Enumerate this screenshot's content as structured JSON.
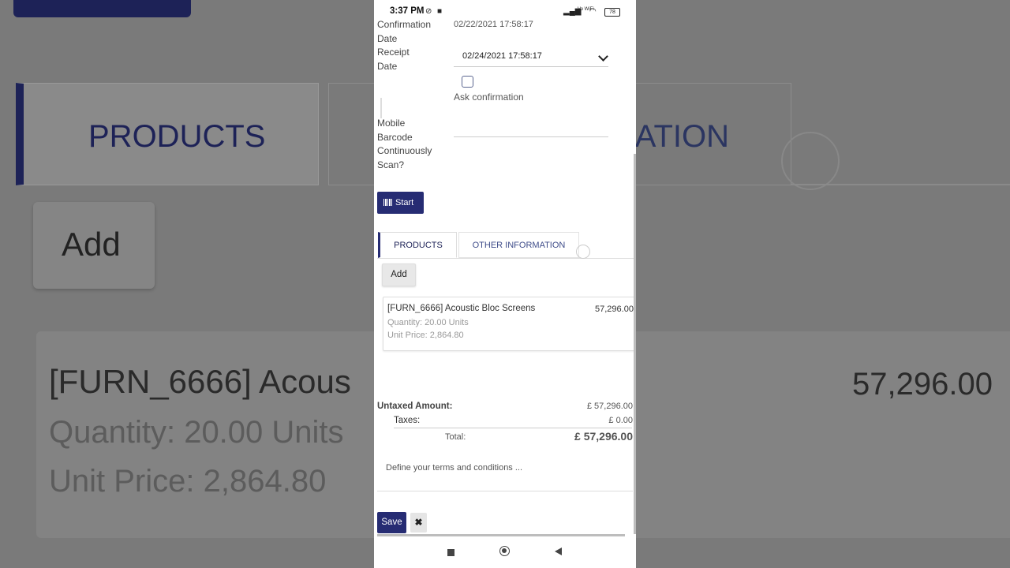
{
  "status_bar": {
    "time": "3:37 PM",
    "network": "Vo WiFi",
    "battery": "78"
  },
  "form": {
    "confirmation_date_label": "Confirmation Date",
    "confirmation_date_value": "02/22/2021 17:58:17",
    "receipt_date_label": "Receipt Date",
    "receipt_date_value": "02/24/2021 17:58:17",
    "ask_confirmation_label": "Ask confirmation",
    "mobile_scan_label": "Mobile Barcode Continuously Scan?",
    "start_button": "Start"
  },
  "tabs": [
    {
      "label": "PRODUCTS",
      "active": true
    },
    {
      "label": "OTHER INFORMATION",
      "active": false
    }
  ],
  "add_button": "Add",
  "lines": [
    {
      "name": "[FURN_6666] Acoustic Bloc Screens",
      "quantity": "Quantity: 20.00 Units",
      "unit_price": "Unit Price: 2,864.80",
      "subtotal": "57,296.00"
    }
  ],
  "totals": {
    "untaxed_label": "Untaxed Amount:",
    "untaxed_value": "£ 57,296.00",
    "taxes_label": "Taxes:",
    "taxes_value": "£ 0.00",
    "total_label": "Total:",
    "total_value": "£ 57,296.00"
  },
  "terms_placeholder": "Define your terms and conditions ...",
  "save_button": "Save",
  "discard_icon": "✖",
  "background_zoom": {
    "tab_products": "PRODUCTS",
    "tab_other": "ATION",
    "add": "Add",
    "line_name": "[FURN_6666] Acous",
    "line_qty": "Quantity: 20.00 Units",
    "line_price": "Unit Price: 2,864.80",
    "subtotal": "57,296.00"
  },
  "colors": {
    "primary": "#262c73",
    "tab_text": "#3f4d8a"
  }
}
